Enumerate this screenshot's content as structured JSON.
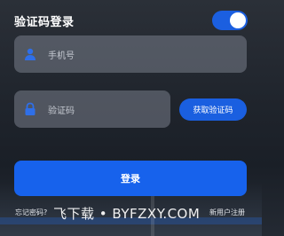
{
  "header": {
    "title": "验证码登录",
    "toggle_on": true
  },
  "phone": {
    "placeholder": "手机号",
    "icon": "user-icon"
  },
  "code": {
    "placeholder": "验证码",
    "icon": "lock-icon"
  },
  "get_code_label": "获取验证码",
  "login_label": "登录",
  "links": {
    "forgot": "忘记密码?",
    "register": "新用户注册"
  },
  "watermark": "飞下载 • BYFZXY.COM",
  "colors": {
    "accent": "#1762ec",
    "field_bg": "#787e8a",
    "background": "#1f242c"
  }
}
